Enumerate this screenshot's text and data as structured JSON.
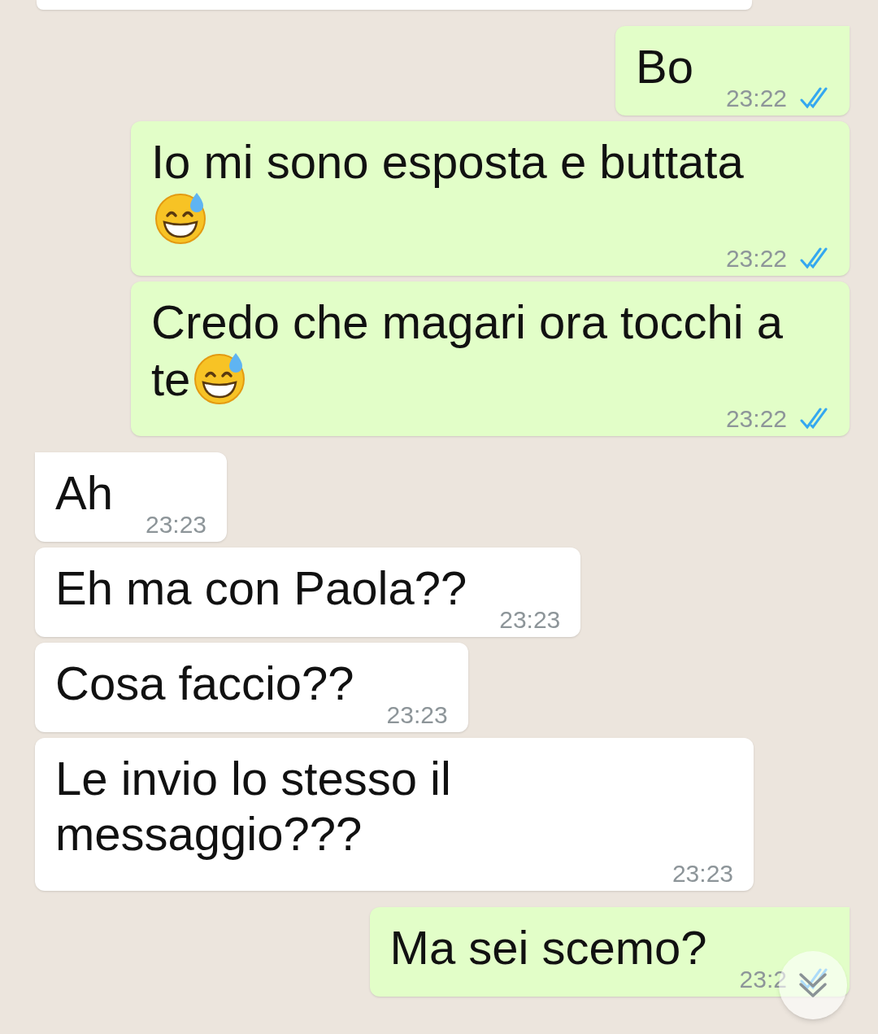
{
  "top_cut_bubble": true,
  "messages": [
    {
      "kind": "sent",
      "text": "Bo",
      "trailing_emoji": false,
      "time": "23:22",
      "read": true
    },
    {
      "kind": "sent",
      "text": "Io mi sono esposta e buttata",
      "trailing_emoji": true,
      "time": "23:22",
      "read": true
    },
    {
      "kind": "sent",
      "text": "Credo che magari ora tocchi a te",
      "trailing_emoji": true,
      "time": "23:22",
      "read": true
    },
    {
      "kind": "received",
      "text": "Ah",
      "trailing_emoji": false,
      "time": "23:23"
    },
    {
      "kind": "received",
      "text": "Eh ma con Paola??",
      "trailing_emoji": false,
      "time": "23:23"
    },
    {
      "kind": "received",
      "text": "Cosa faccio??",
      "trailing_emoji": false,
      "time": "23:23"
    },
    {
      "kind": "received",
      "text": "Le invio lo stesso il messaggio???",
      "trailing_emoji": false,
      "time": "23:23"
    },
    {
      "kind": "sent",
      "text": "Ma sei scemo?",
      "trailing_emoji": false,
      "time": "23:2",
      "read": true
    }
  ],
  "scroll_down_button": true
}
